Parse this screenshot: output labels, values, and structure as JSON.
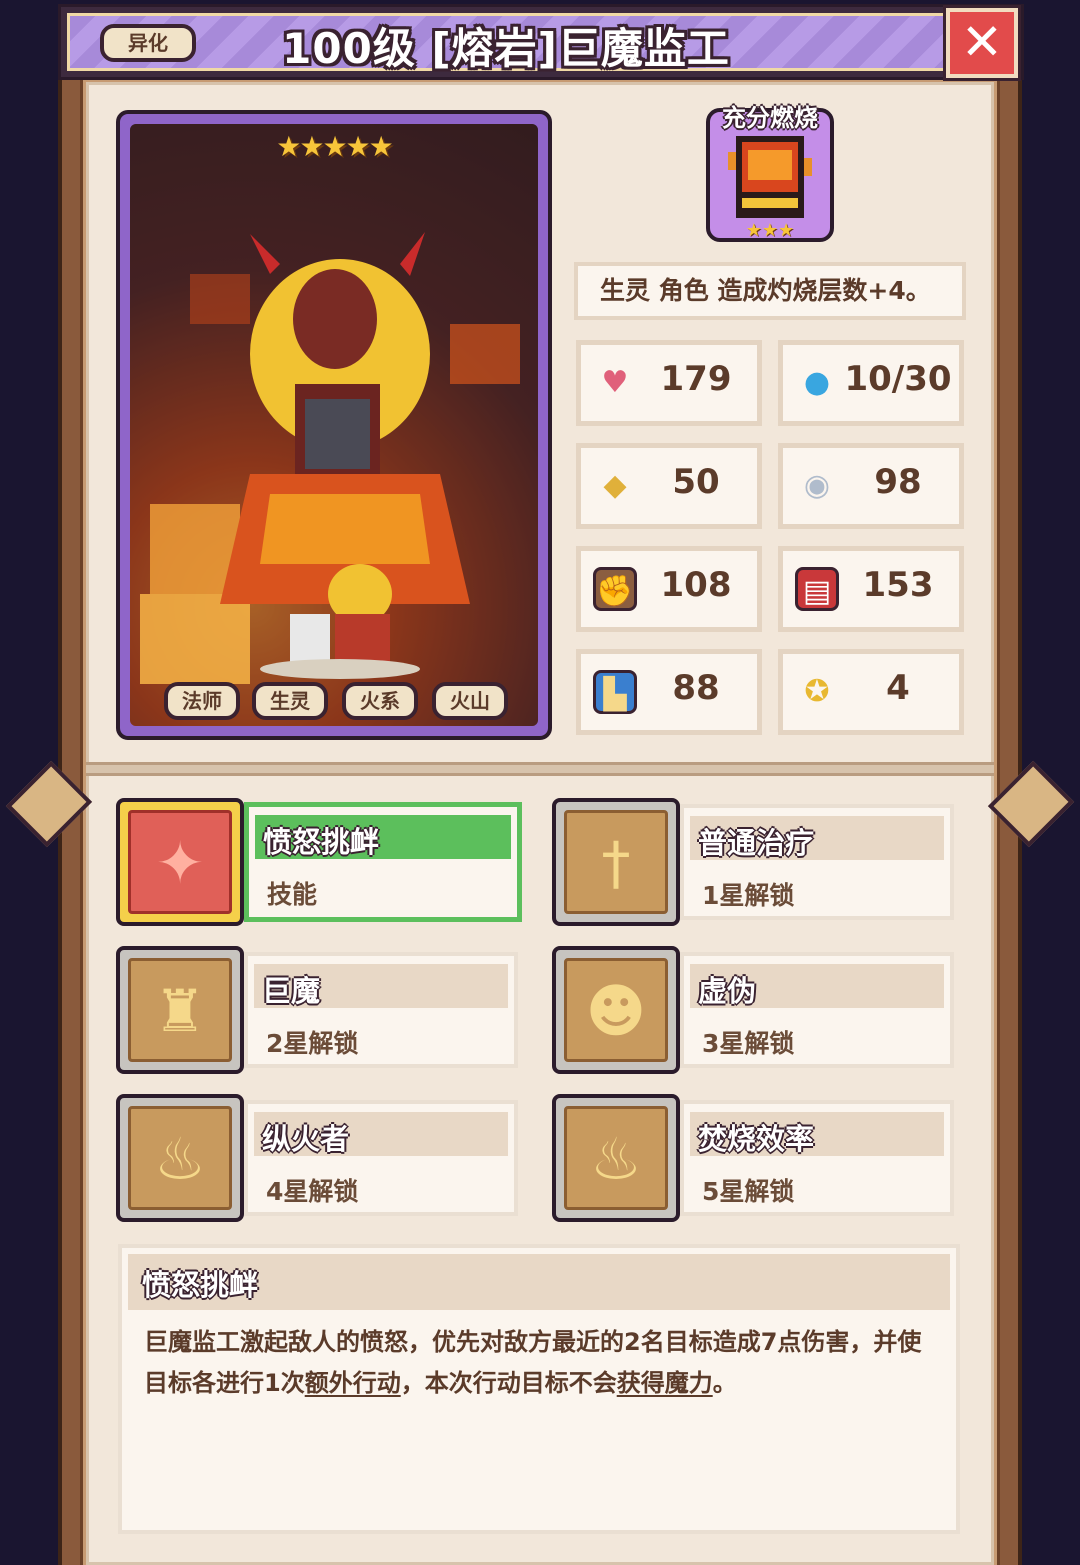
{
  "header": {
    "variant_tag": "异化",
    "title": "100级 [熔岩]巨魔监工",
    "close_symbol": "✕"
  },
  "card": {
    "stars": "★★★★★",
    "tags": [
      "法师",
      "生灵",
      "火系",
      "火山"
    ]
  },
  "relic": {
    "label": "充分燃烧",
    "stars": "★★★",
    "effect": "生灵 角色 造成灼烧层数+4。"
  },
  "stats": [
    {
      "icon": "heart-icon",
      "value": "179"
    },
    {
      "icon": "mana-drop-icon",
      "value": "10/30"
    },
    {
      "icon": "shield-icon",
      "value": "50"
    },
    {
      "icon": "magic-shield-icon",
      "value": "98"
    },
    {
      "icon": "fist-icon",
      "value": "108"
    },
    {
      "icon": "spellbook-icon",
      "value": "153"
    },
    {
      "icon": "boot-icon",
      "value": "88"
    },
    {
      "icon": "crit-icon",
      "value": "4"
    }
  ],
  "skills": [
    {
      "name": "愤怒挑衅",
      "sub": "技能",
      "icon": "taunt-icon",
      "selected": true
    },
    {
      "name": "普通治疗",
      "sub": "1星解锁",
      "icon": "sword-icon"
    },
    {
      "name": "巨魔",
      "sub": "2星解锁",
      "icon": "troll-icon"
    },
    {
      "name": "虚伪",
      "sub": "3星解锁",
      "icon": "mask-icon"
    },
    {
      "name": "纵火者",
      "sub": "4星解锁",
      "icon": "flame-spirit-icon"
    },
    {
      "name": "焚烧效率",
      "sub": "5星解锁",
      "icon": "flame-spirit-icon"
    }
  ],
  "description": {
    "title": "愤怒挑衅",
    "text_1": "巨魔监工激起敌人的愤怒，优先对敌方最近的2名目标造成7点伤害，并使目标各进行1次",
    "link_1": "额外行动",
    "text_2": "，本次行动目标不会",
    "link_2": "获得魔力",
    "text_3": "。"
  },
  "colors": {
    "title_bar": "#a78ad9",
    "card_border": "#8f65c9",
    "selected_skill": "#5cbf5c",
    "panel_bg": "#f2e7da"
  }
}
